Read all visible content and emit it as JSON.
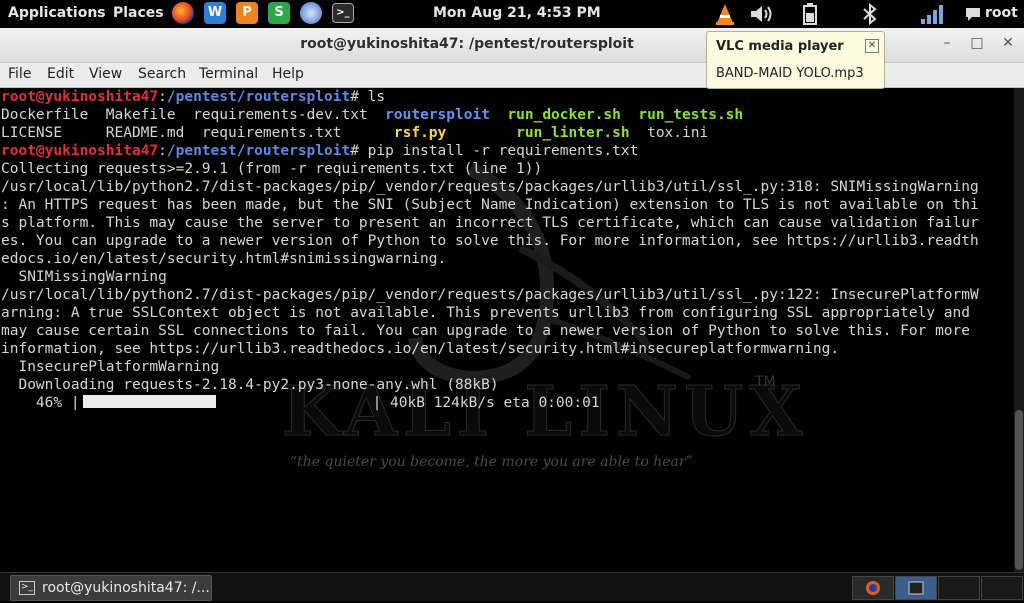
{
  "top_panel": {
    "applications": "Applications",
    "places": "Places",
    "clock": "Mon Aug 21,  4:53 PM",
    "user": "root"
  },
  "window": {
    "title": "root@yukinoshita47: /pentest/routersploit",
    "menu": [
      "File",
      "Edit",
      "View",
      "Search",
      "Terminal",
      "Help"
    ]
  },
  "notification": {
    "title": "VLC media player",
    "body": "BAND-MAID YOLO.mp3"
  },
  "terminal": {
    "prompt_user": "root@yukinoshita47",
    "prompt_path": "/pentest/routersploit",
    "cmd1": "ls",
    "ls_items": {
      "dockerfile": "Dockerfile",
      "makefile": "Makefile",
      "req_dev": "requirements-dev.txt",
      "routersploit": "routersploit",
      "run_docker": "run_docker.sh",
      "run_tests": "run_tests.sh",
      "license": "LICENSE",
      "readme": "README.md",
      "requirements": "requirements.txt",
      "rsf": "rsf.py",
      "run_linter": "run_linter.sh",
      "tox": "tox.ini"
    },
    "cmd2": "pip install -r requirements.txt",
    "out_collecting": "Collecting requests>=2.9.1 (from -r requirements.txt (line 1))",
    "out_warn1": "/usr/local/lib/python2.7/dist-packages/pip/_vendor/requests/packages/urllib3/util/ssl_.py:318: SNIMissingWarning\n: An HTTPS request has been made, but the SNI (Subject Name Indication) extension to TLS is not available on thi\ns platform. This may cause the server to present an incorrect TLS certificate, which can cause validation failur\nes. You can upgrade to a newer version of Python to solve this. For more information, see https://urllib3.readth\nedocs.io/en/latest/security.html#snimissingwarning.\n  SNIMissingWarning",
    "out_warn2": "/usr/local/lib/python2.7/dist-packages/pip/_vendor/requests/packages/urllib3/util/ssl_.py:122: InsecurePlatformW\narning: A true SSLContext object is not available. This prevents urllib3 from configuring SSL appropriately and\nmay cause certain SSL connections to fail. You can upgrade to a newer version of Python to solve this. For more\ninformation, see https://urllib3.readthedocs.io/en/latest/security.html#insecureplatformwarning.\n  InsecurePlatformWarning",
    "out_downloading": "  Downloading requests-2.18.4-py2.py3-none-any.whl (88kB)",
    "progress_pct": "    46% |",
    "progress_tail": "| 40kB 124kB/s eta 0:00:01",
    "progress_value": 0.46
  },
  "background": {
    "logo": "KALI LINUX",
    "tm": "TM",
    "slogan": "“the quieter you become, the more you are able to hear”"
  },
  "taskbar": {
    "task_label": "root@yukinoshita47: /..."
  },
  "colors": {
    "prompt_user": "#e0303a",
    "prompt_path": "#5d8ae0",
    "directory": "#6495ed",
    "executable": "#89e234",
    "python_file": "#ffd64f",
    "notification_bg": "#fdfbe0"
  }
}
